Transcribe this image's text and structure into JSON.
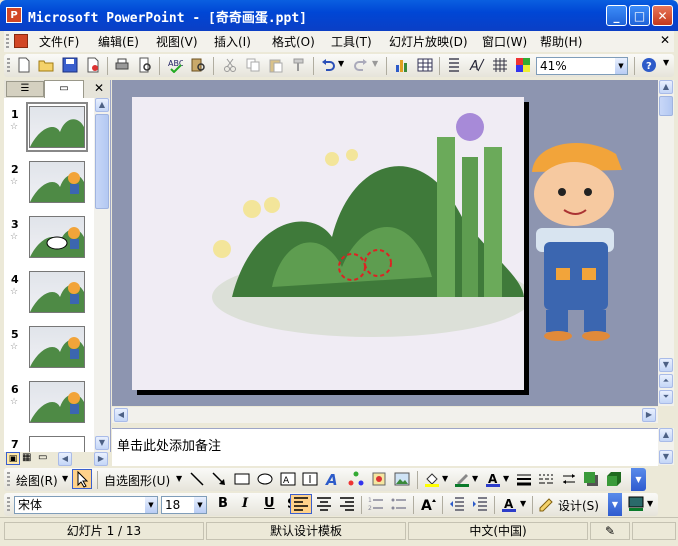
{
  "window": {
    "title": "Microsoft PowerPoint - [奇奇画蛋.ppt]",
    "app_icon": "P"
  },
  "menu": {
    "items": [
      "文件(F)",
      "编辑(E)",
      "视图(V)",
      "插入(I)",
      "格式(O)",
      "工具(T)",
      "幻灯片放映(D)",
      "窗口(W)",
      "帮助(H)"
    ]
  },
  "standard_toolbar": {
    "zoom_value": "41%"
  },
  "slides_pane": {
    "thumbnails": [
      {
        "number": "1"
      },
      {
        "number": "2"
      },
      {
        "number": "3"
      },
      {
        "number": "4"
      },
      {
        "number": "5"
      },
      {
        "number": "6"
      },
      {
        "number": "7"
      }
    ]
  },
  "notes": {
    "placeholder": "单击此处添加备注"
  },
  "drawing_toolbar": {
    "draw_label": "绘图(R)",
    "autoshape_label": "自选图形(U)"
  },
  "format_toolbar": {
    "font_name": "宋体",
    "font_size": "18",
    "bold": "B",
    "italic": "I",
    "underline": "U",
    "design_label": "设计(S)"
  },
  "status": {
    "slide_position": "幻灯片 1 / 13",
    "template": "默认设计模板",
    "language": "中文(中国)"
  },
  "colors": {
    "titlebar": "#0046D5",
    "editor_bg": "#8D95B0",
    "selected_thumb_border": "#808080"
  }
}
